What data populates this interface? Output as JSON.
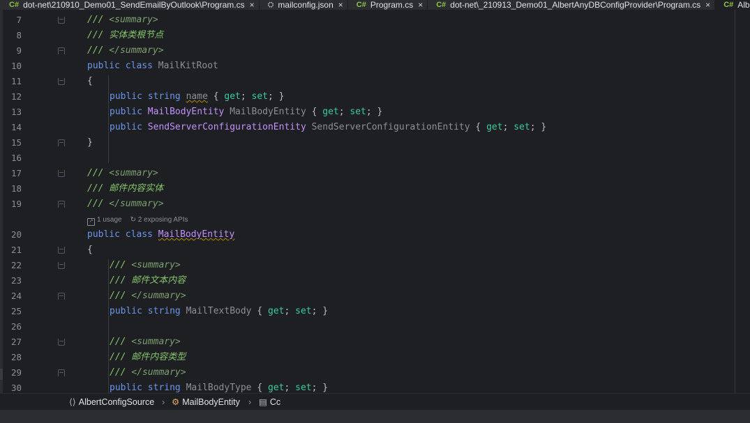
{
  "tabs": [
    {
      "icon": "C#",
      "label": "dot-net\\210910_Demo01_SendEmailByOutlook\\Program.cs",
      "close": "×"
    },
    {
      "icon": "json",
      "label": "mailconfig.json",
      "close": "×"
    },
    {
      "icon": "C#",
      "label": "Program.cs",
      "close": "×"
    },
    {
      "icon": "C#",
      "label": "dot-net\\_210913_Demo01_AlbertAnyDBConfigProvider\\Program.cs",
      "close": "×"
    },
    {
      "icon": "C#",
      "label": "AlbertC",
      "close": ""
    }
  ],
  "editor": {
    "line_numbers": [
      "7",
      "8",
      "9",
      "10",
      "11",
      "12",
      "13",
      "14",
      "15",
      "16",
      "17",
      "18",
      "19",
      "20",
      "21",
      "22",
      "23",
      "24",
      "25",
      "26",
      "27",
      "28",
      "29",
      "30"
    ],
    "code": {
      "l7": [
        "///",
        " <summary>"
      ],
      "l8": [
        "///",
        " 实体类根节点"
      ],
      "l9": [
        "///",
        " </summary>"
      ],
      "l10": [
        "public",
        " ",
        "class",
        " ",
        "MailKitRoot"
      ],
      "l11": [
        "{"
      ],
      "l12": [
        "public",
        " ",
        "string",
        " ",
        "name",
        " { ",
        "get",
        "; ",
        "set",
        "; }"
      ],
      "l13": [
        "public",
        " ",
        "MailBodyEntity",
        " ",
        "MailBodyEntity",
        " { ",
        "get",
        "; ",
        "set",
        "; }"
      ],
      "l14": [
        "public",
        " ",
        "SendServerConfigurationEntity",
        " ",
        "SendServerConfigurationEntity",
        " { ",
        "get",
        "; ",
        "set",
        "; }"
      ],
      "l15": [
        "}"
      ],
      "l17": [
        "///",
        " <summary>"
      ],
      "l18": [
        "///",
        " 邮件内容实体"
      ],
      "l19": [
        "///",
        " </summary>"
      ],
      "l20": [
        "public",
        " ",
        "class",
        " ",
        "MailBodyEntity"
      ],
      "l21": [
        "{"
      ],
      "l22": [
        "///",
        " <summary>"
      ],
      "l23": [
        "///",
        " 邮件文本内容"
      ],
      "l24": [
        "///",
        " </summary>"
      ],
      "l25": [
        "public",
        " ",
        "string",
        " ",
        "MailTextBody",
        " { ",
        "get",
        "; ",
        "set",
        "; }"
      ],
      "l27": [
        "///",
        " <summary>"
      ],
      "l28": [
        "///",
        " 邮件内容类型"
      ],
      "l29": [
        "///",
        " </summary>"
      ],
      "l30": [
        "public",
        " ",
        "string",
        " ",
        "MailBodyType",
        " { ",
        "get",
        "; ",
        "set",
        "; }"
      ]
    },
    "inlay_hints": {
      "usages": "1 usage",
      "apis": "2 exposing APIs"
    }
  },
  "breadcrumb": {
    "items": [
      "AlbertConfigSource",
      "MailBodyEntity",
      "Cc"
    ],
    "separator": "›"
  },
  "colors": {
    "keyword": "#6c95eb",
    "comment": "#85c46c",
    "type": "#c191ff",
    "accessor": "#39cc9b",
    "background": "#1e1f22"
  }
}
